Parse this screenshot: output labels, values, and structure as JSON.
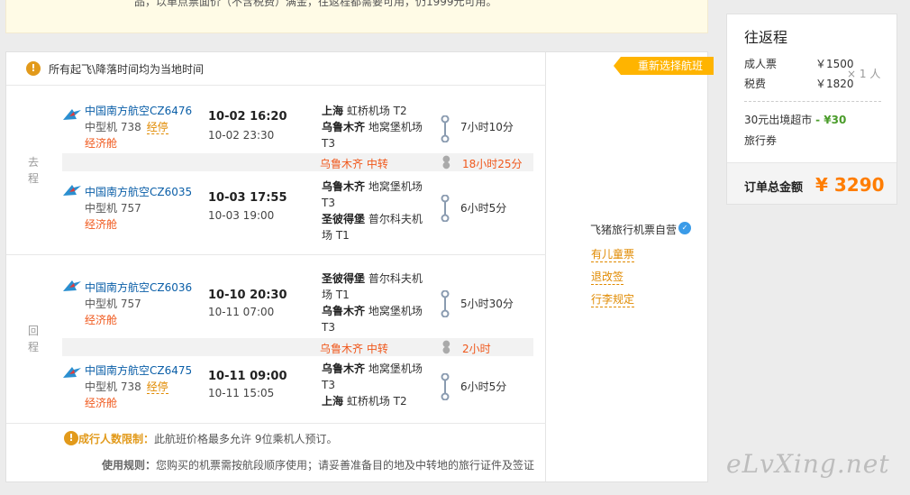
{
  "notice": {
    "text": "品，以単点票面价（不含税费）满金，往返程都需要可用，仍1999元可用。"
  },
  "tip": {
    "text": "所有起飞\\降落时间均为当地时间"
  },
  "outbound": {
    "label": "去程",
    "segments": [
      {
        "airline": "中国南方航空CZ6476",
        "plane": "中型机 738",
        "codeshare": "经停",
        "cabin": "经济舱",
        "dep_time": "10-02 16:20",
        "arr_time": "10-02 23:30",
        "from_city": "上海",
        "from_airport": "虹桥机场 T2",
        "to_city": "乌鲁木齐",
        "to_airport": "地窝堡机场 T3",
        "duration": "7小时10分"
      },
      {
        "airline": "中国南方航空CZ6035",
        "plane": "中型机 757",
        "codeshare": "",
        "cabin": "经济舱",
        "dep_time": "10-03 17:55",
        "arr_time": "10-03 19:00",
        "from_city": "乌鲁木齐",
        "from_airport": "地窝堡机场 T3",
        "to_city": "圣彼得堡",
        "to_airport": "普尔科夫机场 T1",
        "duration": "6小时5分"
      }
    ],
    "transfer": {
      "city": "乌鲁木齐",
      "label": "中转",
      "wait": "18小时25分"
    }
  },
  "return": {
    "label": "回程",
    "segments": [
      {
        "airline": "中国南方航空CZ6036",
        "plane": "中型机 757",
        "codeshare": "",
        "cabin": "经济舱",
        "dep_time": "10-10 20:30",
        "arr_time": "10-11 07:00",
        "from_city": "圣彼得堡",
        "from_airport": "普尔科夫机场 T1",
        "to_city": "乌鲁木齐",
        "to_airport": "地窝堡机场 T3",
        "duration": "5小时30分"
      },
      {
        "airline": "中国南方航空CZ6475",
        "plane": "中型机 738",
        "codeshare": "经停",
        "cabin": "经济舱",
        "dep_time": "10-11 09:00",
        "arr_time": "10-11 15:05",
        "from_city": "乌鲁木齐",
        "from_airport": "地窝堡机场 T3",
        "to_city": "上海",
        "to_airport": "虹桥机场 T2",
        "duration": "6小时5分"
      }
    ],
    "transfer": {
      "city": "乌鲁木齐",
      "label": "中转",
      "wait": "2小时"
    }
  },
  "limit": {
    "label": "成行人数限制：",
    "text": "此航班价格最多允许 9位乘机人预订。"
  },
  "rule": {
    "label": "使用规则：",
    "text": "您购买的机票需按航段顺序使用；请妥善准备目的地及中转地的旅行证件及签证"
  },
  "side": {
    "rebook": "重新选择航班",
    "seller": "飞猪旅行机票自营",
    "links": [
      "有儿童票",
      "退改签",
      "行李规定"
    ]
  },
  "summary": {
    "title": "往返程",
    "adult_label": "成人票",
    "adult_price": "￥1500",
    "tax_label": "税费",
    "tax_price": "￥1820",
    "multiplier": "× 1 人",
    "coupon_label": "30元出境超市",
    "coupon_value": "- ¥30",
    "voucher_label": "旅行券",
    "total_label": "订单总金额",
    "total_value": "¥ 3290"
  },
  "watermark": "eLvXing.net",
  "colors": {
    "accent": "#ff7d00",
    "link": "#0b5fa8",
    "warn": "#e29a1b",
    "red": "#f0581c",
    "green": "#4a9c2a"
  }
}
